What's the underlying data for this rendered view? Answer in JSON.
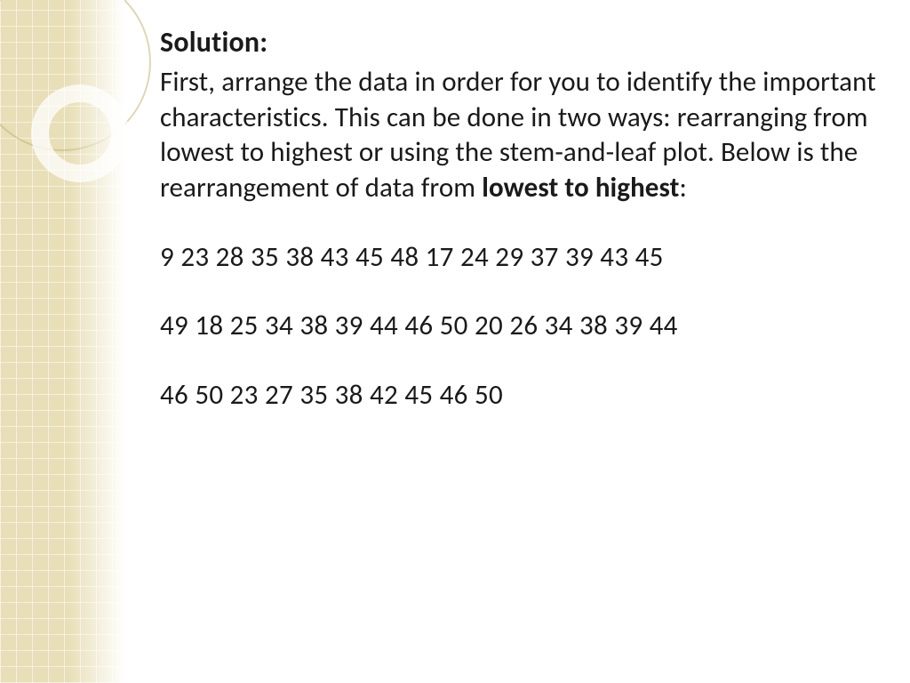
{
  "slide": {
    "heading": "Solution:",
    "paragraph_part1": "First, arrange the data in order for you to identify the important characteristics.  This can be done in two ways: rearranging from lowest to highest or using the stem-and-leaf plot.  Below is the rearrangement of data from ",
    "paragraph_bold": "lowest to highest",
    "paragraph_part2": ":",
    "data_line1": "9 23 28 35 38 43 45 48 17 24 29 37 39 43 45",
    "data_line2": "49 18 25 34 38 39 44 46 50 20 26 34 38 39 44",
    "data_line3": "46 50 23 27 35 38 42 45 46 50"
  }
}
